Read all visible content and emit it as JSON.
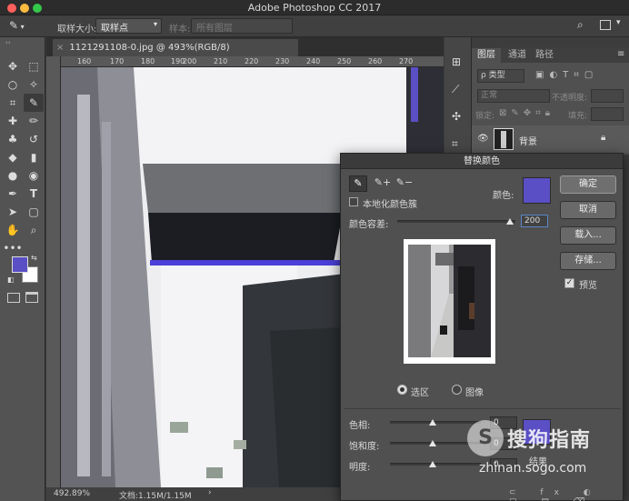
{
  "app": {
    "title": "Adobe Photoshop CC 2017"
  },
  "options_bar": {
    "sample_size_label": "取样大小:",
    "sample_size_value": "取样点",
    "sample_label": "样本:",
    "sample_value": "所有图层"
  },
  "document": {
    "tab_title": "1121291108-0.jpg @ 493%(RGB/8)",
    "zoom": "492.89%",
    "doc_info": "文档:1.15M/1.15M",
    "ruler_ticks": [
      "160",
      "170",
      "180",
      "190",
      "200",
      "210",
      "220",
      "230",
      "240",
      "250",
      "260",
      "270"
    ]
  },
  "layers_panel": {
    "tabs": [
      "图层",
      "通道",
      "路径"
    ],
    "filter_label": "ρ 类型",
    "blend_mode": "正常",
    "opacity_label": "不透明度:",
    "lock_label": "锁定:",
    "fill_label": "填充:",
    "layer_name": "背景"
  },
  "dialog": {
    "title": "替换颜色",
    "localized_label": "本地化颜色簇",
    "color_label": "颜色:",
    "fuzziness_label": "颜色容差:",
    "fuzziness_value": "200",
    "fuzziness_fraction": 0.95,
    "ok": "确定",
    "cancel": "取消",
    "load": "载入...",
    "save": "存储...",
    "preview_label": "预览",
    "selection_label": "选区",
    "image_label": "图像",
    "hue_label": "色相:",
    "saturation_label": "饱和度:",
    "lightness_label": "明度:",
    "hue_value": "0",
    "saturation_value": "0",
    "lightness_value": "0",
    "result_label": "结果",
    "selected_color": "#5a4fc4",
    "result_color": "#5a4fc4"
  },
  "watermark": {
    "brand": "搜狗指南",
    "domain": "zhinan.sogo.com"
  },
  "colors": {
    "foreground": "#5a4fc4",
    "background": "#ffffff"
  }
}
